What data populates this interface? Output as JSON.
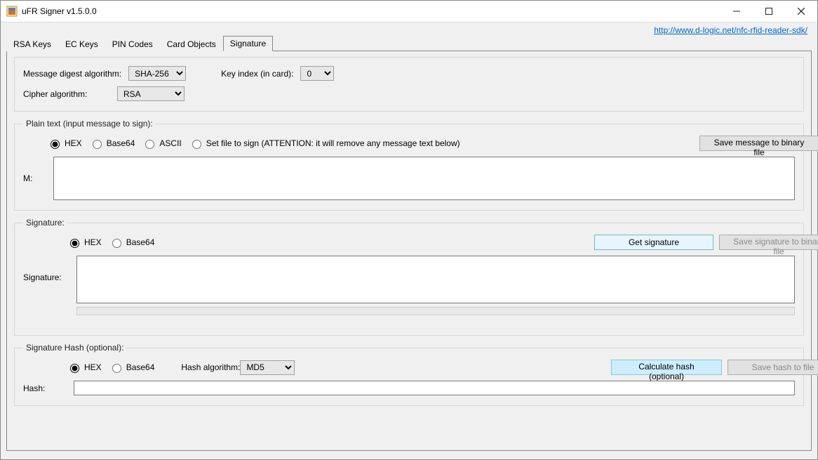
{
  "window": {
    "title": "uFR Signer v1.5.0.0"
  },
  "link": {
    "url_text": "http://www.d-logic.net/nfc-rfid-reader-sdk/"
  },
  "tabs": {
    "rsa": "RSA Keys",
    "ec": "EC Keys",
    "pin": "PIN Codes",
    "card": "Card Objects",
    "sig": "Signature"
  },
  "topgroup": {
    "digest_label": "Message digest algorithm:",
    "digest_value": "SHA-256",
    "keyidx_label": "Key index (in card):",
    "keyidx_value": "0",
    "cipher_label": "Cipher algorithm:",
    "cipher_value": "RSA"
  },
  "plain": {
    "legend": "Plain text (input message to sign):",
    "radio_hex": "HEX",
    "radio_b64": "Base64",
    "radio_ascii": "ASCII",
    "radio_file": "Set file to sign (ATTENTION: it will remove any message text below)",
    "save_btn": "Save message to binary file",
    "m_label": "M:",
    "m_value": ""
  },
  "signature": {
    "legend": "Signature:",
    "radio_hex": "HEX",
    "radio_b64": "Base64",
    "get_btn": "Get signature",
    "save_btn": "Save signature to binary file",
    "sig_label": "Signature:",
    "sig_value": ""
  },
  "sighash": {
    "legend": "Signature Hash (optional):",
    "radio_hex": "HEX",
    "radio_b64": "Base64",
    "hashalg_label": "Hash algorithm:",
    "hashalg_value": "MD5",
    "calc_btn": "Calculate hash (optional)",
    "save_btn": "Save hash to file",
    "hash_label": "Hash:",
    "hash_value": ""
  }
}
